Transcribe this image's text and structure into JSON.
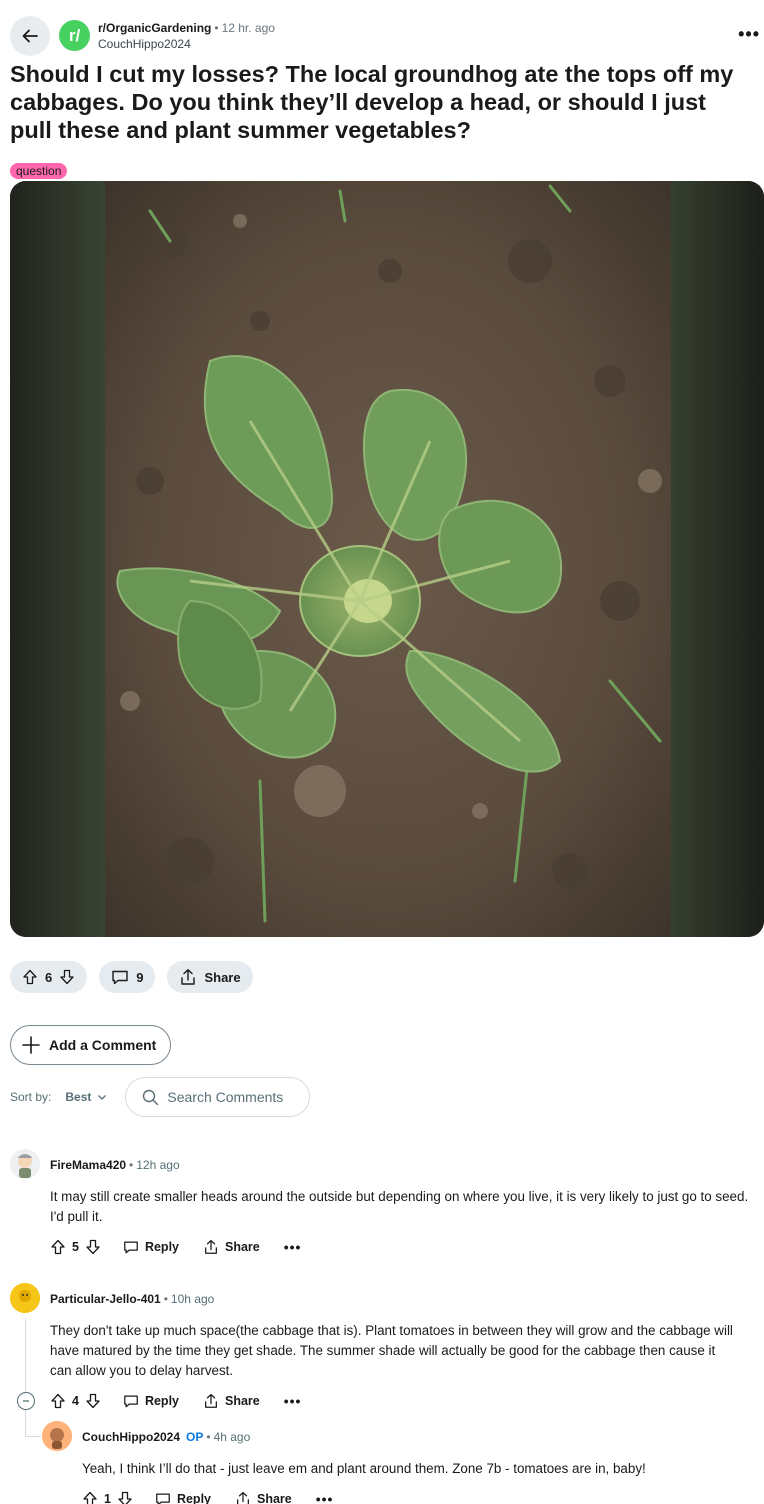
{
  "post": {
    "subreddit": "r/OrganicGardening",
    "subreddit_initial": "r/",
    "time": "12 hr. ago",
    "author": "CouchHippo2024",
    "more": "•••",
    "title": "Should I cut my losses? The local groundhog ate the tops off my cabbages. Do you think they’ll develop a head, or should I just pull these and plant summer vegetables?",
    "flair": "question",
    "flair_color": "#ff66ac",
    "brand_color": "#46d160"
  },
  "actions": {
    "votes": "6",
    "comments": "9",
    "share": "Share"
  },
  "add_comment": "Add a Comment",
  "sort": {
    "label": "Sort by:",
    "value": "Best",
    "search_placeholder": "Search Comments"
  },
  "comments": [
    {
      "user": "FireMama420",
      "time": "12h ago",
      "body": "It may still create smaller heads around the outside but depending on where you live, it is very likely to just go to seed. I'd pull it.",
      "votes": "5",
      "reply": "Reply",
      "share": "Share",
      "more": "•••"
    },
    {
      "user": "Particular-Jello-401",
      "time": "10h ago",
      "body": "They don't take up much space(the cabbage that is). Plant tomatoes in between they will grow and the cabbage will have matured by the time they get shade. The summer shade will actually be good for the cabbage then cause it can allow you to delay harvest.",
      "votes": "4",
      "reply": "Reply",
      "share": "Share",
      "more": "•••"
    },
    {
      "user": "CouchHippo2024",
      "op": "OP",
      "time": "4h ago",
      "body": "Yeah, I think I’ll do that - just leave em and plant around them. Zone 7b - tomatoes are in, baby!",
      "votes": "1",
      "reply": "Reply",
      "share": "Share",
      "more": "•••"
    }
  ],
  "separator": "•"
}
